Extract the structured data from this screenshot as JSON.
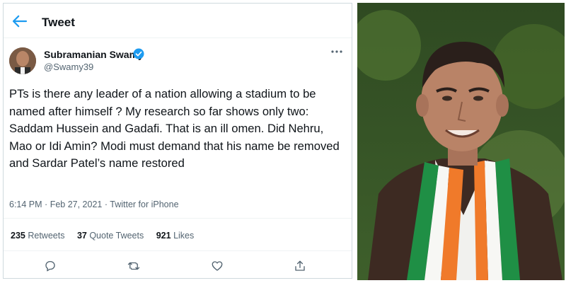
{
  "header": {
    "title": "Tweet"
  },
  "author": {
    "name": "Subramanian Swamy",
    "handle": "@Swamy39"
  },
  "tweet": {
    "text": "PTs is there any leader of a nation allowing a stadium to be named after himself ? My research so far shows only two: Saddam Hussein and Gadafi. That is an ill omen. Did Nehru, Mao or Idi Amin? Modi must demand that his name be removed and Sardar Patel’s name restored",
    "time": "6:14 PM",
    "date": "Feb 27, 2021",
    "source": "Twitter for iPhone"
  },
  "stats": {
    "retweets_count": "235",
    "retweets_label": "Retweets",
    "quotes_count": "37",
    "quotes_label": "Quote Tweets",
    "likes_count": "921",
    "likes_label": "Likes"
  },
  "icons": {
    "back": "arrow-left-icon",
    "verified": "verified-badge-icon",
    "more": "more-icon",
    "reply": "reply-icon",
    "retweet": "retweet-icon",
    "like": "heart-icon",
    "share": "share-icon"
  },
  "colors": {
    "accent": "#1d9bf0",
    "secondary_text": "#536471",
    "border": "#eff3f4"
  },
  "photo": {
    "description": "portrait of the tweet author"
  }
}
